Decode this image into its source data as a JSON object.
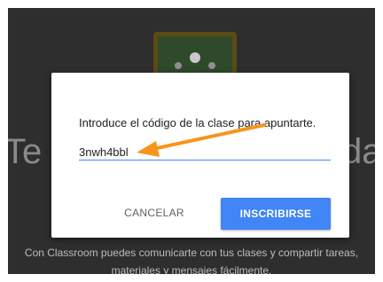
{
  "background": {
    "heading_left": "Te c",
    "heading_right": "da",
    "caption_line1": "Con Classroom puedes comunicarte con tus clases y compartir tareas,",
    "caption_line2": "materiales y mensajes fácilmente.",
    "icon": "classroom-icon"
  },
  "dialog": {
    "prompt": "Introduce el código de la clase para apuntarte.",
    "code_value": "3nwh4bbl",
    "cancel_label": "CANCELAR",
    "join_label": "INSCRIBIRSE"
  },
  "annotation": {
    "icon": "arrow-icon",
    "color": "#f7941d"
  },
  "colors": {
    "accent": "#4285f4",
    "backdrop": "#2e2e2e"
  }
}
